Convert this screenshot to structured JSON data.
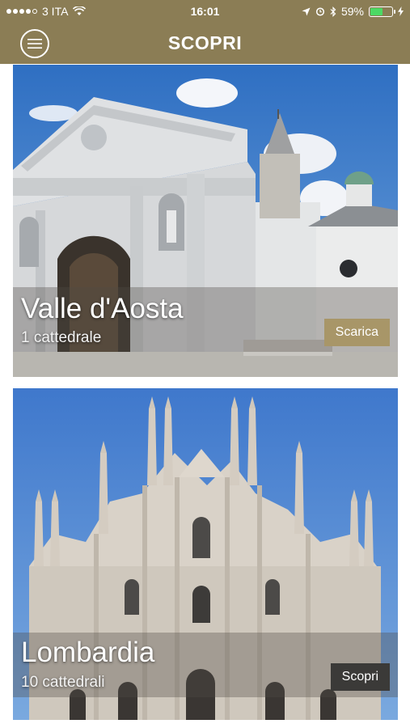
{
  "status": {
    "carrier": "3 ITA",
    "time": "16:01",
    "battery": "59%",
    "battery_level": 0.59
  },
  "header": {
    "title": "SCOPRI"
  },
  "regions": [
    {
      "name": "Valle d'Aosta",
      "count": "1 cattedrale",
      "action": "Scarica"
    },
    {
      "name": "Lombardia",
      "count": "10 cattedrali",
      "action": "Scopri"
    }
  ],
  "colors": {
    "header_bg": "#8b7d55",
    "download_button": "#a89668",
    "discover_button": "#3b3a38"
  }
}
